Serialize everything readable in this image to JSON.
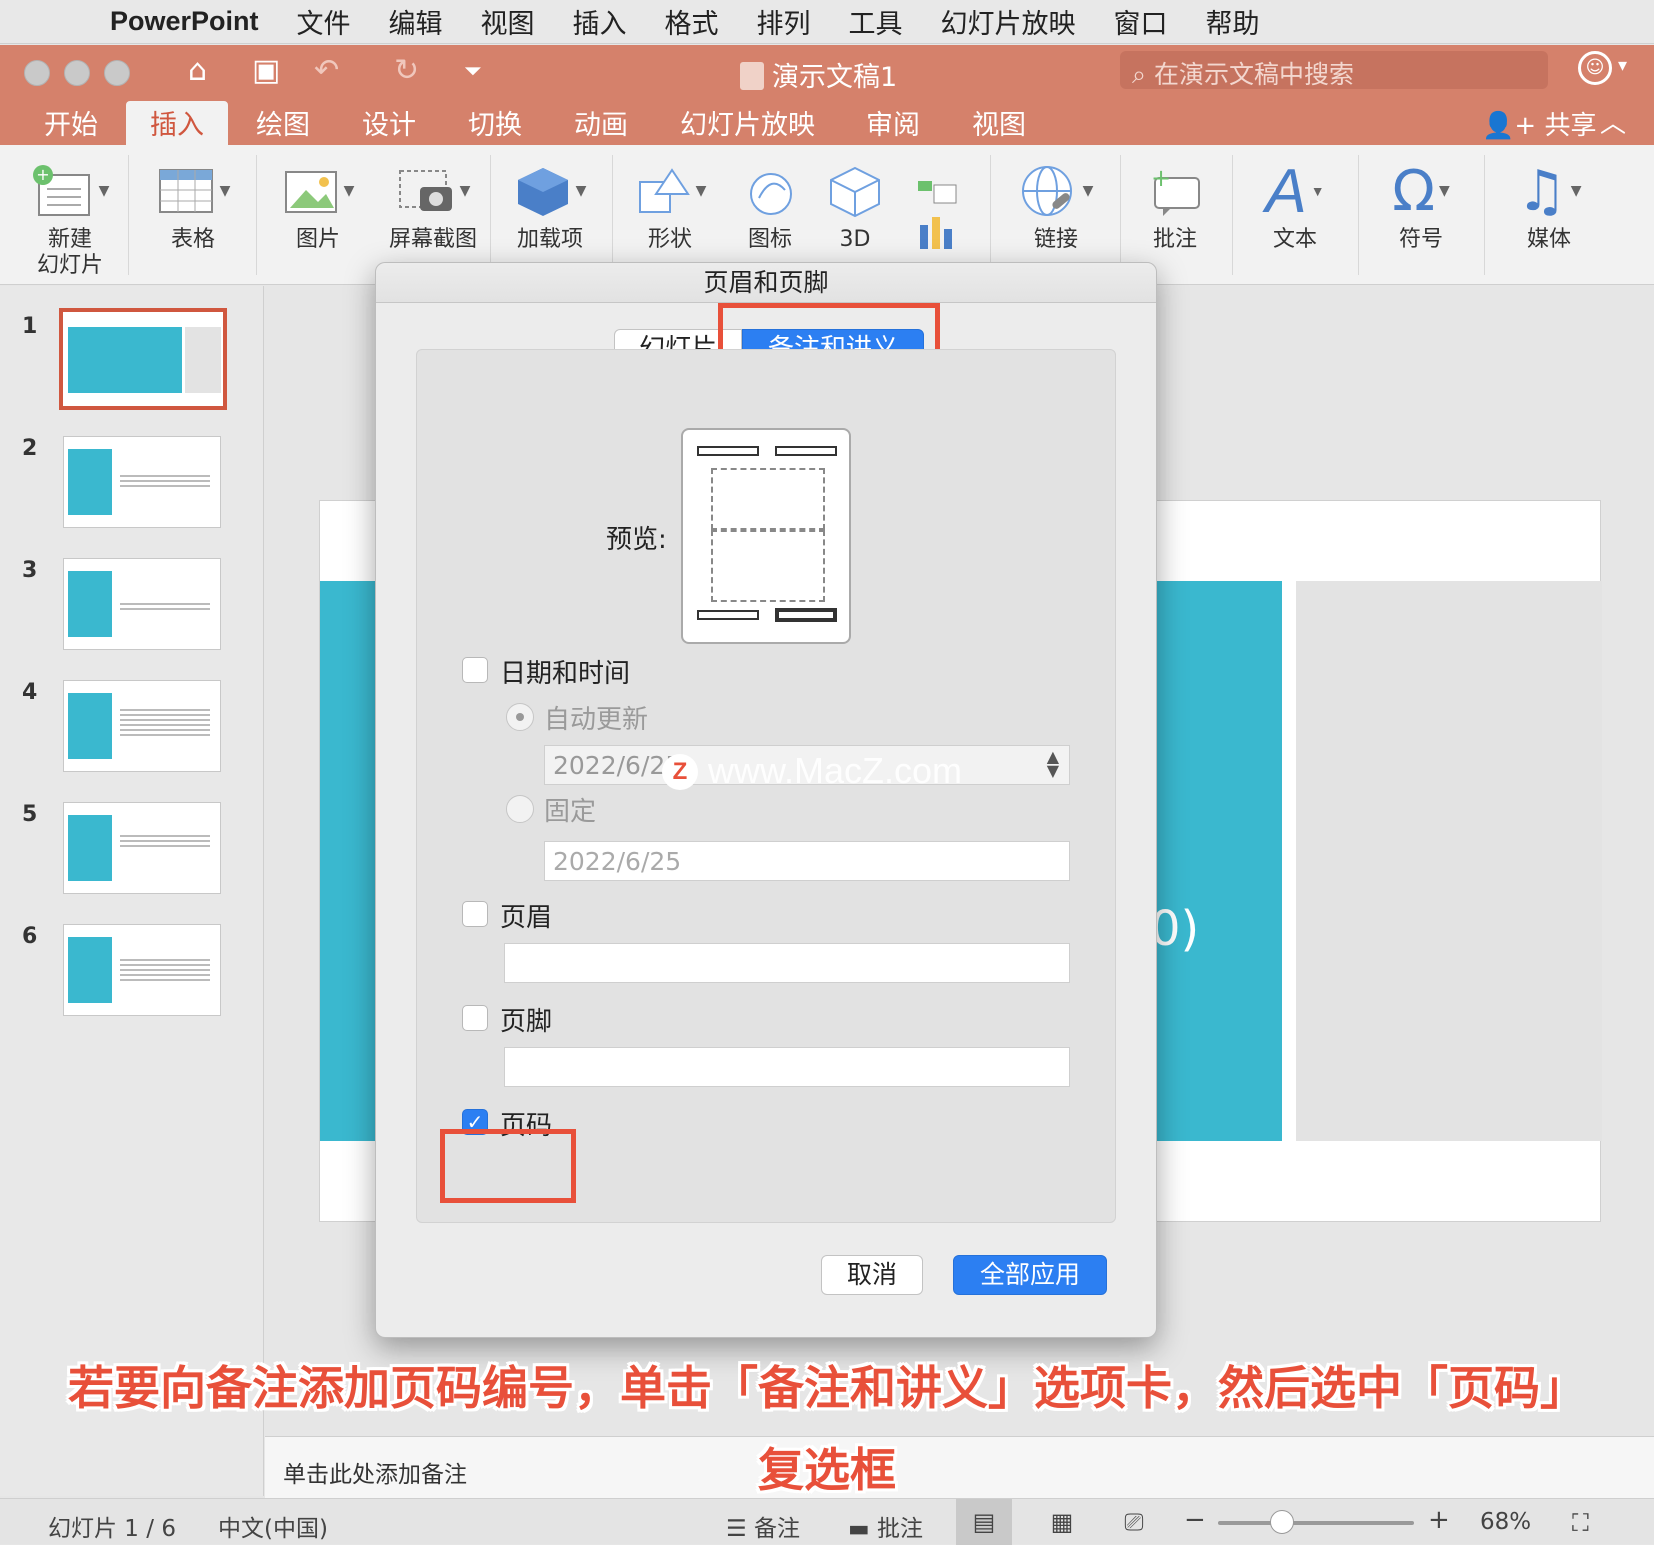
{
  "menubar": {
    "app_name": "PowerPoint",
    "items": [
      "文件",
      "编辑",
      "视图",
      "插入",
      "格式",
      "排列",
      "工具",
      "幻灯片放映",
      "窗口",
      "帮助"
    ]
  },
  "titlebar": {
    "document_title": "演示文稿1",
    "search_placeholder": "在演示文稿中搜索"
  },
  "ribbon_tabs": {
    "items": [
      "开始",
      "插入",
      "绘图",
      "设计",
      "切换",
      "动画",
      "幻灯片放映",
      "审阅",
      "视图"
    ],
    "active": "插入",
    "share_label": "共享"
  },
  "ribbon": {
    "new_slide": "新建\n幻灯片",
    "table": "表格",
    "picture": "图片",
    "screenshot": "屏幕截图",
    "addins": "加载项",
    "shapes": "形状",
    "icons": "图标",
    "models_3d": "3D",
    "link": "链接",
    "comment": "批注",
    "text": "文本",
    "symbol": "符号",
    "media": "媒体"
  },
  "thumbnails": {
    "numbers": [
      "1",
      "2",
      "3",
      "4",
      "5",
      "6"
    ],
    "selected_index": 1
  },
  "dialog": {
    "title": "页眉和页脚",
    "tab_slides": "幻灯片",
    "tab_notes": "备注和讲义",
    "active_tab": "备注和讲义",
    "preview_label": "预览:",
    "date_time_label": "日期和时间",
    "date_time_checked": false,
    "auto_update_label": "自动更新",
    "auto_update_value": "2022/6/25",
    "fixed_label": "固定",
    "fixed_value": "2022/6/25",
    "header_label": "页眉",
    "header_checked": false,
    "header_value": "",
    "footer_label": "页脚",
    "footer_checked": false,
    "footer_value": "",
    "page_number_label": "页码",
    "page_number_checked": true,
    "cancel_label": "取消",
    "apply_all_label": "全部应用"
  },
  "slide": {
    "visible_fragment": "0)"
  },
  "notes": {
    "placeholder": "单击此处添加备注"
  },
  "statusbar": {
    "slide_counter": "幻灯片 1 / 6",
    "language": "中文(中国)",
    "notes_label": "备注",
    "comments_label": "批注",
    "zoom": "68%"
  },
  "watermark": "www.MacZ.com",
  "caption": {
    "line1": "若要向备注添加页码编号，单击「备注和讲义」选项卡，然后选中「页码」",
    "line2": "复选框"
  },
  "colors": {
    "accent_orange": "#d5816b",
    "dialog_blue": "#2c7ff2",
    "highlight_red": "#e8503a",
    "slide_teal": "#3ab8cf"
  }
}
